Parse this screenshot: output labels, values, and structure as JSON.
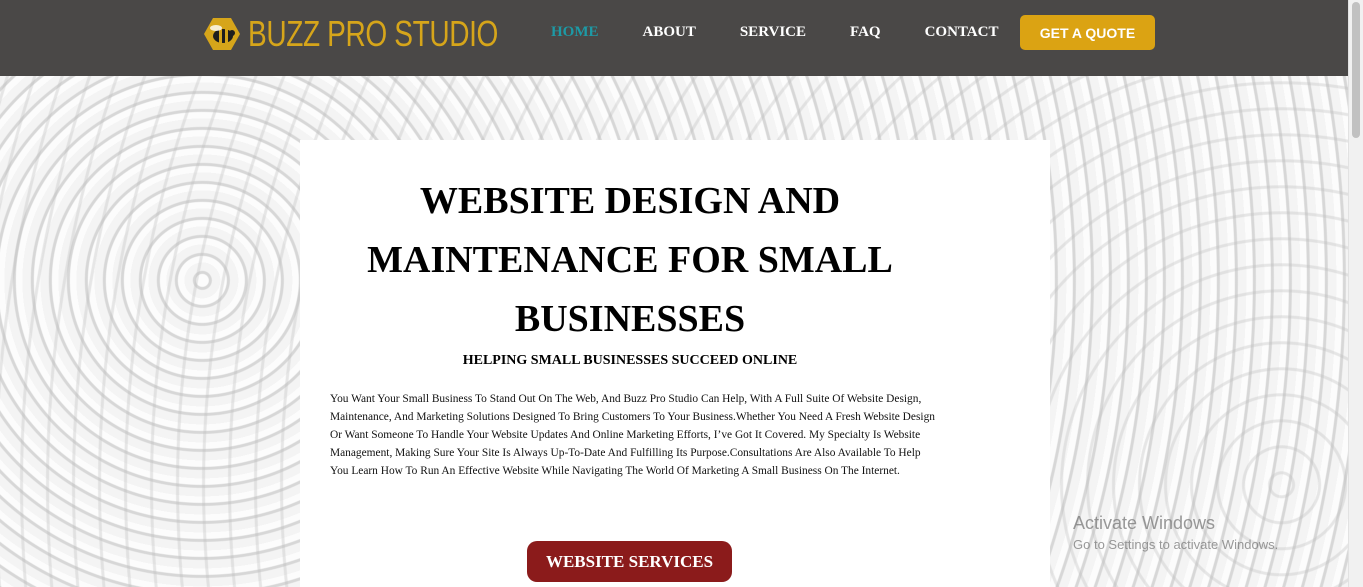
{
  "brand": {
    "name": "BUZZ PRO STUDIO",
    "icon": "bee-icon",
    "color": "#d6a51a"
  },
  "nav": {
    "items": [
      "HOME",
      "ABOUT",
      "SERVICE",
      "FAQ",
      "CONTACT"
    ],
    "active": "HOME",
    "active_color": "#1d9aa6",
    "cta": "GET A QUOTE",
    "cta_color": "#dba313"
  },
  "hero": {
    "title": "WEBSITE DESIGN AND MAINTENANCE FOR SMALL BUSINESSES",
    "subtitle": "HELPING SMALL BUSINESSES SUCCEED ONLINE",
    "body": "You Want Your Small Business To Stand Out On The Web, And Buzz Pro Studio Can Help, With A Full Suite Of Website Design, Maintenance, And Marketing Solutions Designed To Bring Customers To Your Business.Whether You Need A Fresh Website Design Or Want Someone To Handle Your Website Updates And Online Marketing Efforts, I’ve Got It Covered. My Specialty Is Website Management, Making Sure Your Site Is Always Up-To-Date And Fulfilling Its Purpose.Consultations Are Also Available To Help You Learn How To Run An Effective Website While Navigating The World Of Marketing A Small Business On The Internet.",
    "button": "WEBSITE SERVICES",
    "button_color": "#8b1b1b"
  },
  "watermark": {
    "title": "Activate Windows",
    "subtitle": "Go to Settings to activate Windows."
  }
}
